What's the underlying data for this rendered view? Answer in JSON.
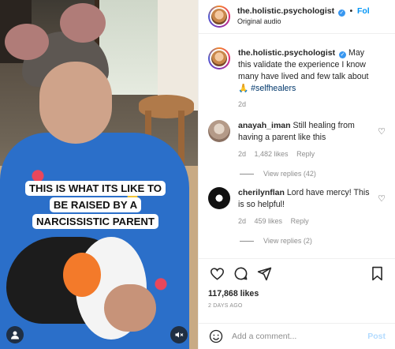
{
  "header": {
    "username": "the.holistic.psychologist",
    "follow_label": "Fol",
    "subtitle": "Original audio"
  },
  "media": {
    "caption": "THIS IS WHAT ITS LIKE TO BE RAISED BY A NARCISSISTIC PARENT"
  },
  "post": {
    "username": "the.holistic.psychologist",
    "text": "May this validate the experience I know many have lived and few talk about 🙏",
    "hashtag": "#selfhealers",
    "time": "2d"
  },
  "comments": [
    {
      "username": "anayah_iman",
      "text": "Still healing from having a parent like this",
      "time": "2d",
      "likes": "1,482 likes",
      "reply": "Reply",
      "view_replies": "View replies (42)"
    },
    {
      "username": "cherilynflan",
      "text": "Lord have mercy! This is so helpful!",
      "time": "2d",
      "likes": "459 likes",
      "reply": "Reply",
      "view_replies": "View replies (2)"
    }
  ],
  "actions": {
    "likes": "117,868 likes",
    "ago": "2 DAYS AGO"
  },
  "add_comment": {
    "placeholder": "Add a comment...",
    "post_label": "Post"
  },
  "colors": {
    "accent": "#0095f6",
    "verified": "#3897f0",
    "post_disabled": "#b3dbff"
  }
}
